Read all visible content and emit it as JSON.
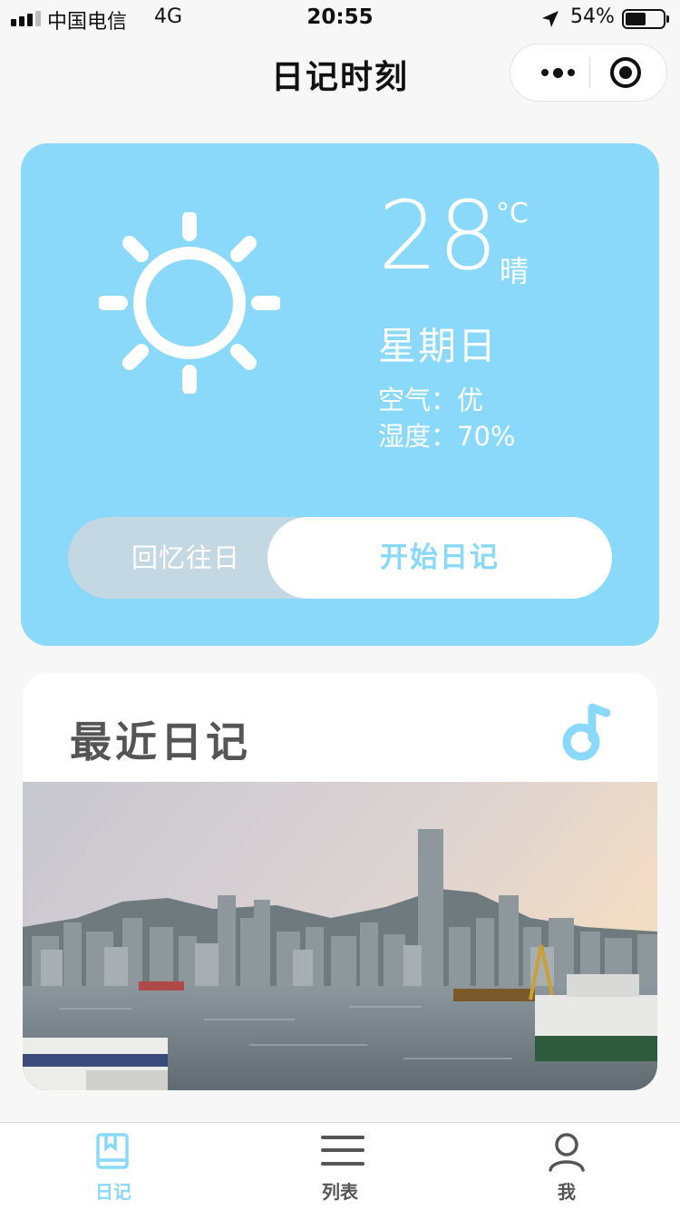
{
  "status_bar": {
    "carrier": "中国电信",
    "network": "4G",
    "time": "20:55",
    "battery": "54%",
    "battery_level": 0.54
  },
  "nav": {
    "title": "日记时刻"
  },
  "weather": {
    "temperature": "28",
    "unit": "°C",
    "condition": "晴",
    "weekday": "星期日",
    "air": "空气：优",
    "humidity": "湿度：70%",
    "icon": "sun-icon"
  },
  "actions": {
    "recall_label": "回忆往日",
    "start_label": "开始日记"
  },
  "recent": {
    "title": "最近日记",
    "icon": "music-note-icon"
  },
  "tabs": [
    {
      "label": "日记",
      "icon": "book-icon",
      "active": true
    },
    {
      "label": "列表",
      "icon": "list-icon",
      "active": false
    },
    {
      "label": "我",
      "icon": "user-icon",
      "active": false
    }
  ],
  "colors": {
    "accent": "#8ad9fb",
    "toggle_bg": "#c3d8e2",
    "title_gray": "#555555"
  }
}
